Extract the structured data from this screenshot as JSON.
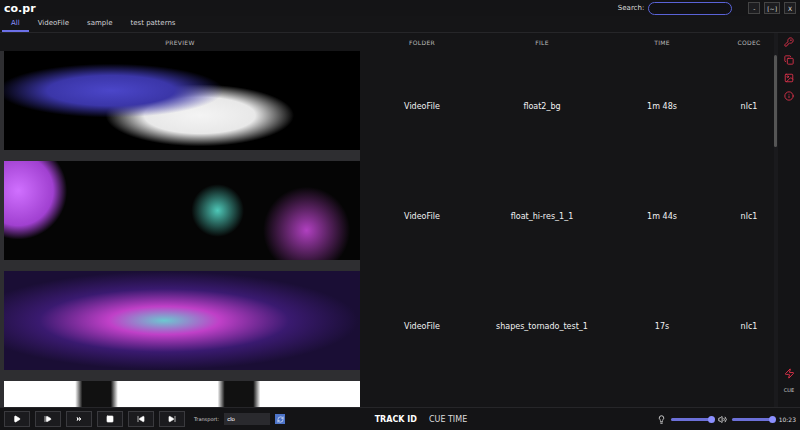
{
  "window": {
    "title": "co.pr",
    "buttons": [
      "-",
      "[~]",
      "X"
    ]
  },
  "search": {
    "label": "Search:",
    "value": ""
  },
  "tabs": [
    {
      "label": "All",
      "selected": true
    },
    {
      "label": "VideoFile",
      "selected": false
    },
    {
      "label": "sample",
      "selected": false
    },
    {
      "label": "test patterns",
      "selected": false
    }
  ],
  "table": {
    "columns": [
      "PREVIEW",
      "FOLDER",
      "FILE",
      "TIME",
      "CODEC"
    ],
    "rows": [
      {
        "folder": "VideoFile",
        "file": "float2_bg",
        "time": "1m 48s",
        "codec": "nlc1"
      },
      {
        "folder": "VideoFile",
        "file": "float_hi-res_1_1",
        "time": "1m 44s",
        "codec": "nlc1"
      },
      {
        "folder": "VideoFile",
        "file": "shapes_tornado_test_1",
        "time": "17s",
        "codec": "nlc1"
      }
    ]
  },
  "sidebar": {
    "bottom_label": "CUE"
  },
  "transport": {
    "label": "Transport:",
    "value": "clo"
  },
  "status": {
    "track_id": "TRACK ID",
    "cue_time": "CUE TIME"
  },
  "sliders": [
    {
      "name": "brightness",
      "level": 0.95
    },
    {
      "name": "volume",
      "level": 0.97
    }
  ],
  "clock": "10:23"
}
